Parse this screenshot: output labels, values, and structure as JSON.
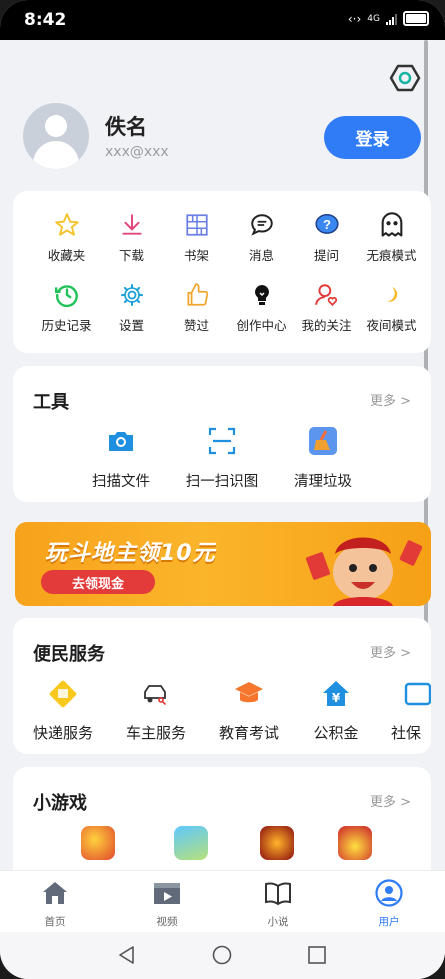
{
  "status_bar": {
    "time": "8:42",
    "network": "4G"
  },
  "profile": {
    "name": "佚名",
    "email": "xxx@xxx",
    "login_label": "登录"
  },
  "shortcuts": [
    {
      "label": "收藏夹",
      "icon": "star-icon"
    },
    {
      "label": "下载",
      "icon": "download-icon"
    },
    {
      "label": "书架",
      "icon": "bookshelf-icon"
    },
    {
      "label": "消息",
      "icon": "message-icon"
    },
    {
      "label": "提问",
      "icon": "question-icon"
    },
    {
      "label": "无痕模式",
      "icon": "ghost-icon"
    },
    {
      "label": "历史记录",
      "icon": "history-icon"
    },
    {
      "label": "设置",
      "icon": "gear-icon"
    },
    {
      "label": "赞过",
      "icon": "thumbs-up-icon"
    },
    {
      "label": "创作中心",
      "icon": "bulb-icon"
    },
    {
      "label": "我的关注",
      "icon": "follow-icon"
    },
    {
      "label": "夜间模式",
      "icon": "moon-icon"
    }
  ],
  "tools": {
    "title": "工具",
    "more": "更多 >",
    "items": [
      {
        "label": "扫描文件",
        "icon": "camera-icon"
      },
      {
        "label": "扫一扫识图",
        "icon": "scan-icon"
      },
      {
        "label": "清理垃圾",
        "icon": "broom-icon"
      }
    ]
  },
  "banner": {
    "title": "玩斗地主领10元",
    "cta": "去领现金"
  },
  "services": {
    "title": "便民服务",
    "more": "更多 >",
    "items": [
      {
        "label": "快递服务",
        "icon": "package-icon"
      },
      {
        "label": "车主服务",
        "icon": "car-icon"
      },
      {
        "label": "教育考试",
        "icon": "graduation-cap-icon"
      },
      {
        "label": "公积金",
        "icon": "house-fund-icon"
      },
      {
        "label": "社保",
        "icon": "social-security-icon"
      }
    ]
  },
  "games": {
    "title": "小游戏",
    "more": "更多 >",
    "count": 4
  },
  "tabs": [
    {
      "label": "首页",
      "icon": "home-icon",
      "active": false
    },
    {
      "label": "视频",
      "icon": "video-icon",
      "active": false
    },
    {
      "label": "小说",
      "icon": "book-icon",
      "active": false
    },
    {
      "label": "用户",
      "icon": "user-icon",
      "active": true
    }
  ],
  "colors": {
    "accent": "#2f7cf6",
    "background": "#f1f2f5",
    "banner": "#fbb52b"
  }
}
